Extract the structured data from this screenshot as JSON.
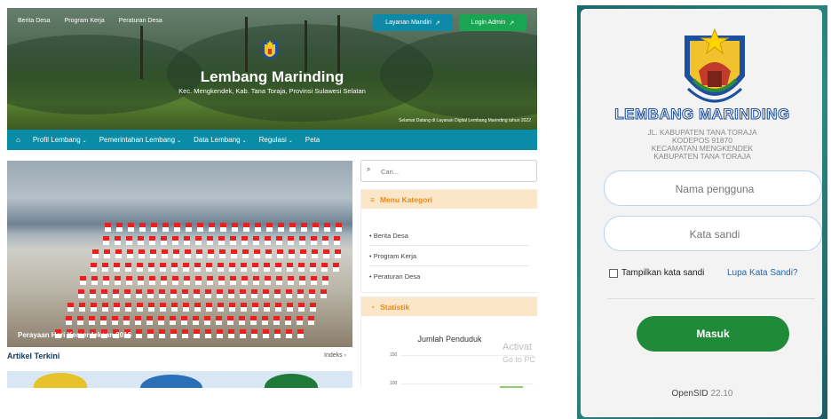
{
  "left_site": {
    "top_links": [
      "Berita Desa",
      "Program Kerja",
      "Peraturan Desa"
    ],
    "btn_layanan": "Layanan Mandiri",
    "btn_login": "Login Admin",
    "title": "Lembang Marinding",
    "subtitle": "Kec. Mengkendek, Kab. Tana Toraja, Provinsi Sulawesi Selatan",
    "welcome": "Selamat Datang di Layanan Digital Lembang Marinding tahun 2022",
    "nav": [
      "Profil Lembang",
      "Pemerintahan Lembang",
      "Data Lembang",
      "Regulasi",
      "Peta"
    ],
    "slide_caption": "Perayaan Hari Kemerdekaan 2016",
    "articles_title": "Artikel Terkini",
    "articles_index": "Indeks",
    "search_placeholder": "Cari...",
    "menu_title": "Menu Kategori",
    "menu_items": [
      "Berita Desa",
      "Program Kerja",
      "Peraturan Desa"
    ],
    "stat_title": "Statistik",
    "chart_title": "Jumlah Penduduk",
    "chart_ticks": [
      "150",
      "100"
    ]
  },
  "login": {
    "title": "LEMBANG MARINDING",
    "address": [
      "JL. KABUPATEN TANA TORAJA",
      "KODEPOS 91870",
      "KECAMATAN MENGKENDEK",
      "KABUPATEN TANA TORAJA"
    ],
    "username_placeholder": "Nama pengguna",
    "password_placeholder": "Kata sandi",
    "show_password": "Tampilkan kata sandi",
    "forgot": "Lupa Kata Sandi?",
    "submit": "Masuk",
    "footer_app": "OpenSID",
    "footer_version": "22.10"
  },
  "watermark": [
    "Activat",
    "Go to PC"
  ],
  "colors": {
    "nav_teal": "#0b8ca6",
    "login_green": "#1e8a3a",
    "accent_orange": "#e8891c"
  }
}
